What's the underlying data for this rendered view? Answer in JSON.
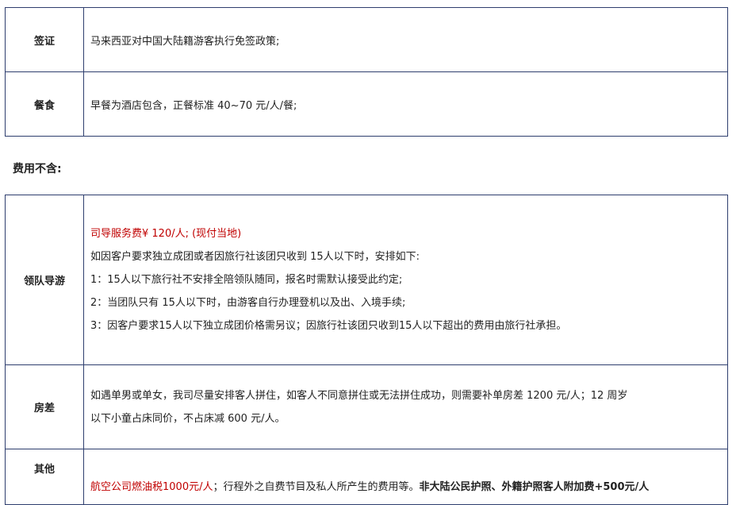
{
  "top_table": {
    "visa": {
      "label": "签证",
      "text": "马来西亚对中国大陆籍游客执行免签政策;"
    },
    "meals": {
      "label": "餐食",
      "text": "早餐为酒店包含，正餐标准 40~70 元/人/餐;"
    }
  },
  "section_heading": "费用不含:",
  "bottom_table": {
    "guide": {
      "label": "领队导游",
      "fee": "司导服务费¥  120/人;   (现付当地)",
      "line1": "如因客户要求独立成团或者因旅行社该团只收到 15人以下时，安排如下:",
      "line2": "1：15人以下旅行社不安排全陪领队随同，报名时需默认接受此约定;",
      "line3": "2：当团队只有 15人以下时，由游客自行办理登机以及出、入境手续;",
      "line4": "3：因客户要求15人以下独立成团价格需另议；因旅行社该团只收到15人以下超出的费用由旅行社承担。"
    },
    "room": {
      "label": "房差",
      "line1": "如遇单男或单女，我司尽量安排客人拼住，如客人不同意拼住或无法拼住成功，则需要补单房差 1200 元/人；12 周岁",
      "line2": "以下小童占床同价，不占床减 600 元/人。"
    },
    "other": {
      "label": "其他",
      "red_part": "航空公司燃油税1000元/人",
      "normal_part": "；行程外之自费节目及私人所产生的费用等。",
      "bold_part": "非大陆公民护照、外籍护照客人附加费+500元/人"
    }
  },
  "colors": {
    "border": "#2e3e6e",
    "highlight_red": "#c00000"
  }
}
